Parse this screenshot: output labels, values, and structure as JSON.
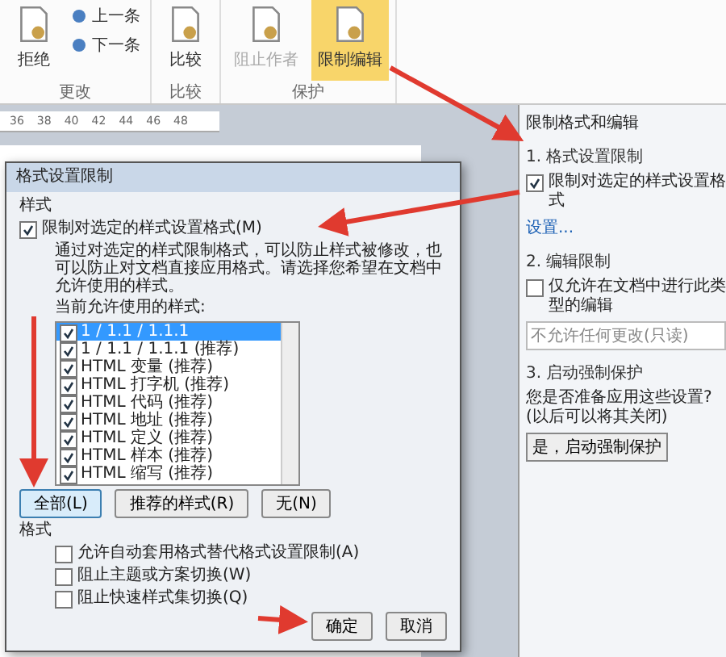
{
  "ribbon": {
    "groups": [
      {
        "label": "更改",
        "buttons": [
          {
            "label": "拒绝",
            "kind": "large",
            "selected": false,
            "disabled": false
          },
          {
            "label": "上一条",
            "kind": "small",
            "selected": false,
            "disabled": false
          },
          {
            "label": "下一条",
            "kind": "small",
            "selected": false,
            "disabled": false
          }
        ]
      },
      {
        "label": "比较",
        "buttons": [
          {
            "label": "比较",
            "kind": "large",
            "selected": false,
            "disabled": false
          }
        ]
      },
      {
        "label": "保护",
        "buttons": [
          {
            "label": "阻止作者",
            "kind": "large",
            "selected": false,
            "disabled": true
          },
          {
            "label": "限制编辑",
            "kind": "large",
            "selected": true,
            "disabled": false
          }
        ]
      }
    ]
  },
  "ruler": {
    "ticks": [
      "36",
      "38",
      "40",
      "42",
      "44",
      "46",
      "48"
    ]
  },
  "pane": {
    "title": "限制格式和编辑",
    "sections": [
      {
        "heading": "1. 格式设置限制",
        "checkbox": {
          "label": "限制对选定的样式设置格式",
          "checked": true
        },
        "link": "设置..."
      },
      {
        "heading": "2. 编辑限制",
        "checkbox": {
          "label": "仅允许在文档中进行此类型的编辑",
          "checked": false
        },
        "dropdown": "不允许任何更改(只读)"
      },
      {
        "heading": "3. 启动强制保护",
        "text": "您是否准备应用这些设置?(以后可以将其关闭)",
        "button": "是，启动强制保护"
      }
    ]
  },
  "dialog": {
    "title": "格式设置限制",
    "styles_group": "样式",
    "limit_checkbox": {
      "label": "限制对选定的样式设置格式(M)",
      "checked": true
    },
    "description": "通过对选定的样式限制格式，可以防止样式被修改，也可以防止对文档直接应用格式。请选择您希望在文档中允许使用的样式。",
    "list_label": "当前允许使用的样式:",
    "styles": [
      {
        "label": "1 / 1.1 / 1.1.1",
        "checked": true,
        "selected": true
      },
      {
        "label": "1 / 1.1 / 1.1.1 (推荐)",
        "checked": true,
        "selected": false
      },
      {
        "label": "HTML 变量 (推荐)",
        "checked": true,
        "selected": false
      },
      {
        "label": "HTML 打字机 (推荐)",
        "checked": true,
        "selected": false
      },
      {
        "label": "HTML 代码 (推荐)",
        "checked": true,
        "selected": false
      },
      {
        "label": "HTML 地址 (推荐)",
        "checked": true,
        "selected": false
      },
      {
        "label": "HTML 定义 (推荐)",
        "checked": true,
        "selected": false
      },
      {
        "label": "HTML 样本 (推荐)",
        "checked": true,
        "selected": false
      },
      {
        "label": "HTML 缩写 (推荐)",
        "checked": true,
        "selected": false
      }
    ],
    "list_buttons": [
      {
        "label": "全部(L)",
        "selected": true
      },
      {
        "label": "推荐的样式(R)",
        "selected": false
      },
      {
        "label": "无(N)",
        "selected": false
      }
    ],
    "format_group": "格式",
    "format_options": [
      {
        "label": "允许自动套用格式替代格式设置限制(A)",
        "checked": false
      },
      {
        "label": "阻止主题或方案切换(W)",
        "checked": false
      },
      {
        "label": "阻止快速样式集切换(Q)",
        "checked": false
      }
    ],
    "buttons": [
      "确定",
      "取消"
    ]
  }
}
